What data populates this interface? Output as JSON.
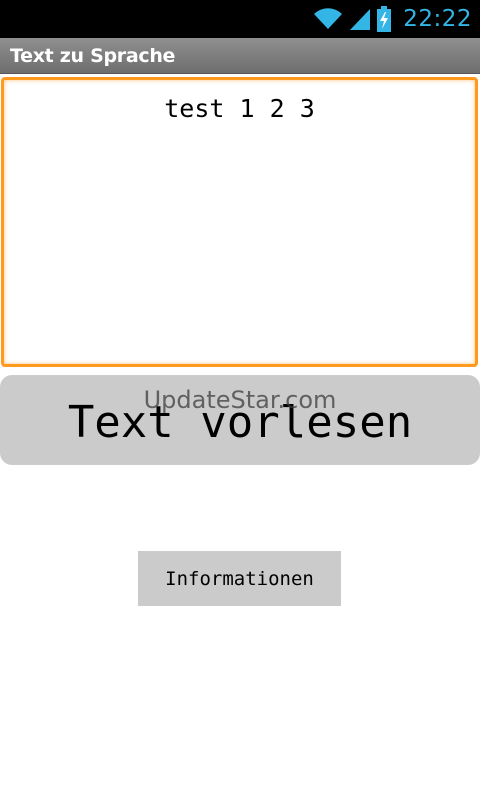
{
  "status_bar": {
    "time": "22:22",
    "icons": [
      "wifi-icon",
      "signal-icon",
      "battery-charging-icon"
    ],
    "accent_color": "#33b5e5"
  },
  "app": {
    "title": "Text zu Sprache"
  },
  "text_input": {
    "value": "test 1 2 3",
    "focus_color": "#ff9a1e"
  },
  "speak_button": {
    "label": "Text vorlesen"
  },
  "watermark": {
    "text": "UpdateStar.com"
  },
  "info_button": {
    "label": "Informationen"
  },
  "colors": {
    "button_bg": "#cbcbcb",
    "title_bar_bg": "#7f7f7f"
  }
}
